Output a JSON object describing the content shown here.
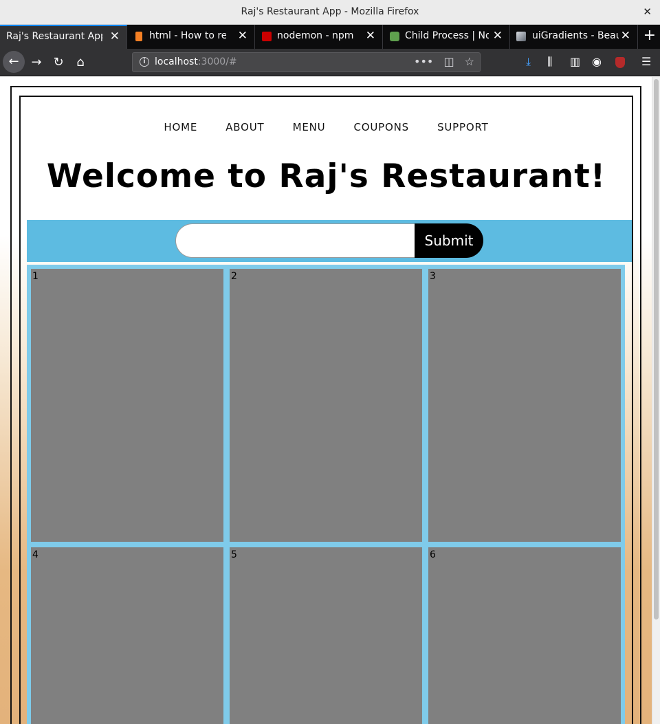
{
  "window": {
    "title": "Raj's Restaurant App - Mozilla Firefox",
    "close_glyph": "✕"
  },
  "tabs": [
    {
      "label": "Raj's Restaurant App",
      "active": true,
      "icon": "none"
    },
    {
      "label": "html - How to remove",
      "active": false,
      "icon": "stackoverflow-icon",
      "icon_color": "#f48024"
    },
    {
      "label": "nodemon - npm",
      "active": false,
      "icon": "npm-icon",
      "icon_color": "#cb0000"
    },
    {
      "label": "Child Process | Node",
      "active": false,
      "icon": "nodejs-icon",
      "icon_color": "#5fa04e"
    },
    {
      "label": "uiGradients - Beautiful",
      "active": false,
      "icon": "uigradients-icon",
      "icon_color": "#8a8f98"
    }
  ],
  "tab_close_glyph": "✕",
  "new_tab_glyph": "+",
  "nav": {
    "back_glyph": "←",
    "forward_glyph": "→",
    "reload_glyph": "↻",
    "home_glyph": "⌂",
    "url_host": "localhost",
    "url_rest": ":3000/#",
    "page_actions_glyph": "•••",
    "pocket_glyph": "◫",
    "bookmark_glyph": "☆",
    "download_glyph": "⤓",
    "library_glyph": "⫼",
    "sidebar_glyph": "▥",
    "account_glyph": "◉",
    "menu_glyph": "☰"
  },
  "site": {
    "nav_links": [
      "HOME",
      "ABOUT",
      "MENU",
      "COUPONS",
      "SUPPORT"
    ],
    "title": "Welcome to Raj's Restaurant!",
    "search": {
      "value": "",
      "placeholder": ""
    },
    "submit_label": "Submit",
    "grid_items": [
      "1",
      "2",
      "3",
      "4",
      "5",
      "6"
    ]
  },
  "colors": {
    "band": "#5dbbe1",
    "grid_bg": "#7fcbea",
    "cell": "#808080",
    "gradient_end": "#e3b27b"
  }
}
